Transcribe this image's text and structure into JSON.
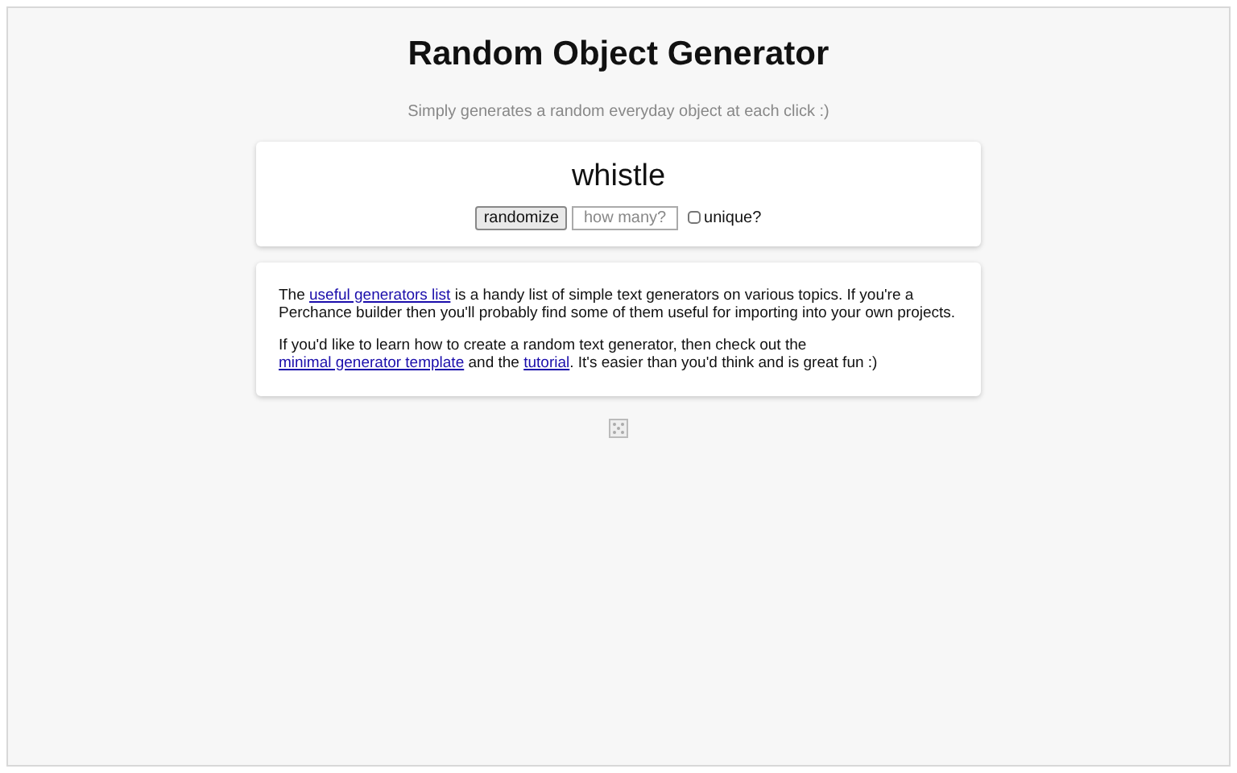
{
  "title": "Random Object Generator",
  "subtitle": "Simply generates a random everyday object at each click :)",
  "result": "whistle",
  "controls": {
    "button": "randomize",
    "count_placeholder": "how many?",
    "unique": {
      "label": "unique?",
      "checked": false
    }
  },
  "info": [
    [
      {
        "kind": "text",
        "text": "The "
      },
      {
        "kind": "link",
        "text": "useful generators list"
      },
      {
        "kind": "text",
        "text": " is a handy list of simple text generators on various topics. If you're a Perchance builder then you'll probably find some of them useful for importing into your own projects."
      }
    ],
    [
      {
        "kind": "text",
        "text": "If you'd like to learn how to create a random text generator, then check out the "
      },
      {
        "kind": "link",
        "text": "minimal generator template"
      },
      {
        "kind": "text",
        "text": " and the "
      },
      {
        "kind": "link",
        "text": "tutorial"
      },
      {
        "kind": "text",
        "text": ". It's easier than you'd think and is great fun :)"
      }
    ]
  ]
}
